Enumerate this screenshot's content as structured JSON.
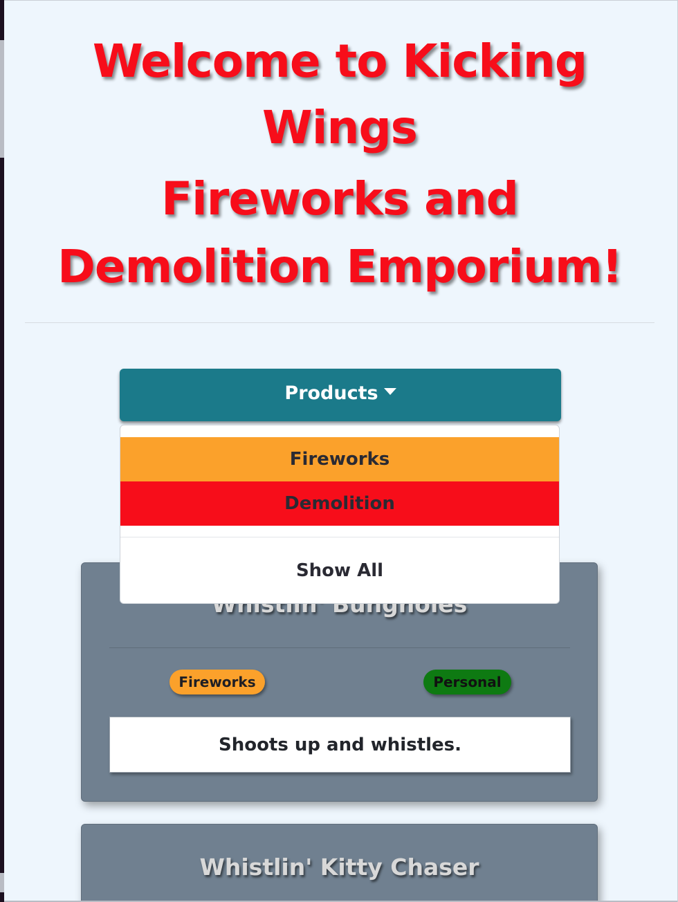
{
  "header": {
    "title_line1": "Welcome to Kicking Wings",
    "title_line2": "Fireworks and Demolition Emporium!"
  },
  "nav": {
    "products_label": "Products"
  },
  "dropdown": {
    "items": [
      {
        "label": "Fireworks",
        "color": "#fba12b"
      },
      {
        "label": "Demolition",
        "color": "#f70d1a"
      }
    ],
    "show_all_label": "Show All"
  },
  "products": [
    {
      "name": "Whistlin' Bungholes",
      "category": "Fireworks",
      "type": "Personal",
      "description": "Shoots up and whistles."
    },
    {
      "name": "Whistlin' Kitty Chaser"
    }
  ],
  "colors": {
    "accent_red": "#f70d1a",
    "button_teal": "#1b7a8a",
    "fireworks_orange": "#fba12b",
    "personal_green": "#0e7a12",
    "card_slate": "#708090",
    "page_bg": "#eef6fd"
  }
}
